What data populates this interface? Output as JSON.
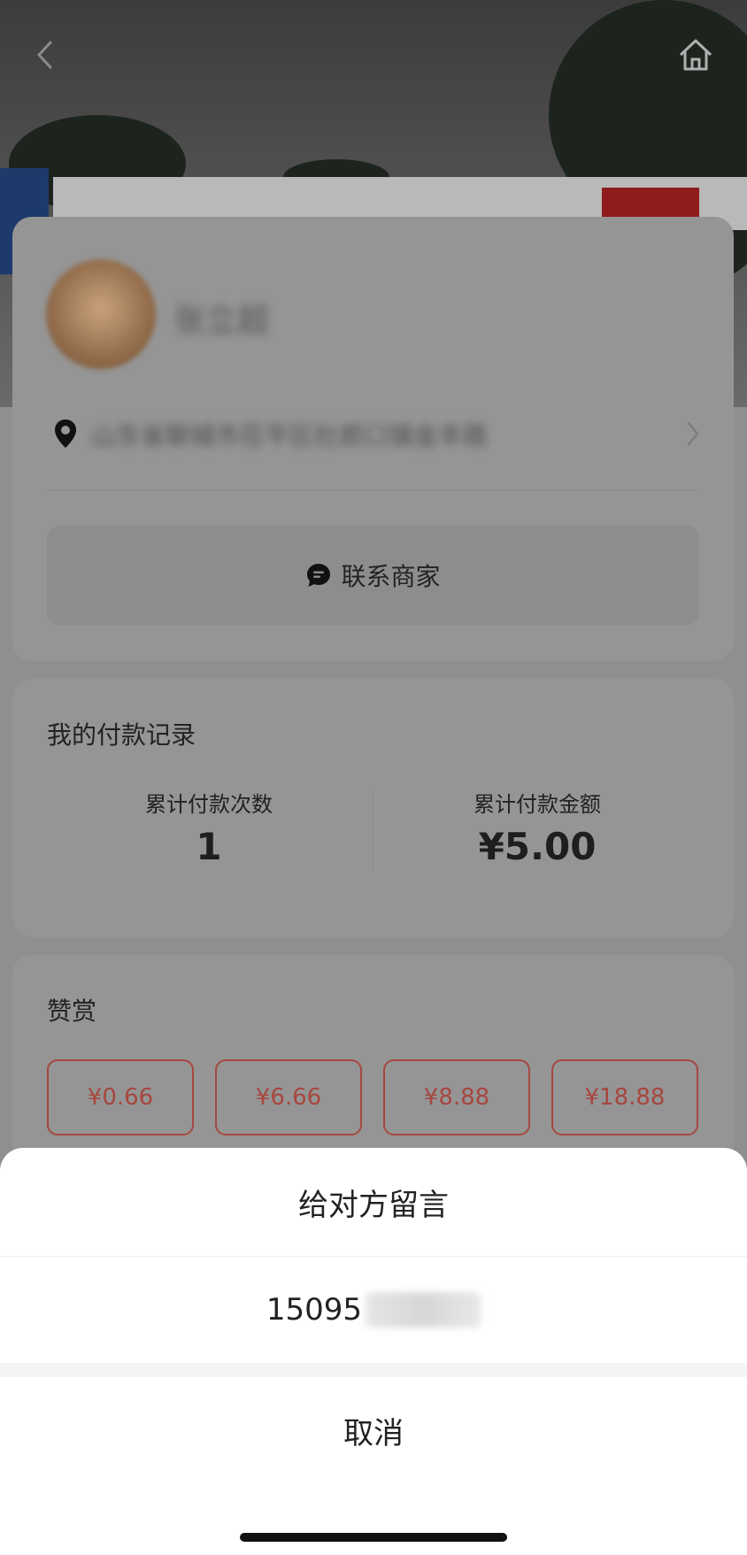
{
  "header": {
    "back_icon": "chevron-left-icon",
    "home_icon": "home-icon"
  },
  "merchant": {
    "name": "张立超",
    "address": "山东省聊城市茌平区杜郎口镇金丰路",
    "location_icon": "map-pin-icon",
    "chevron_icon": "chevron-right-icon",
    "contact_button": "联系商家",
    "contact_icon": "chat-bubble-icon"
  },
  "payment_record": {
    "title": "我的付款记录",
    "count_label": "累计付款次数",
    "count_value": "1",
    "amount_label": "累计付款金额",
    "amount_value": "¥5.00"
  },
  "tip": {
    "title": "赞赏",
    "amounts": [
      "¥0.66",
      "¥6.66",
      "¥8.88",
      "¥18.88"
    ],
    "accent_color": "#e0473a"
  },
  "action_sheet": {
    "title": "给对方留言",
    "phone_prefix": "15095",
    "cancel": "取消"
  }
}
